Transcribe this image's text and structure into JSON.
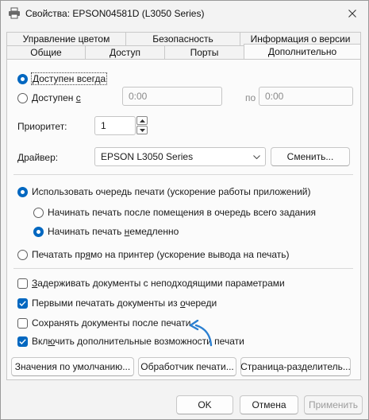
{
  "window": {
    "title": "Свойства: EPSON04581D (L3050 Series)"
  },
  "tabs": {
    "back_row": [
      "Управление цветом",
      "Безопасность",
      "Информация о версии"
    ],
    "front_row": [
      "Общие",
      "Доступ",
      "Порты",
      "Дополнительно"
    ],
    "active": "Дополнительно"
  },
  "availability": {
    "always_label": "Доступен всегда",
    "from_label_pre": "Доступен ",
    "from_label_ul": "с",
    "selected": "always",
    "from_time": "0:00",
    "to_label": "по",
    "to_time": "0:00"
  },
  "priority": {
    "label": "Приоритет:",
    "value": "1"
  },
  "driver": {
    "label": "Драйвер:",
    "value": "EPSON L3050 Series",
    "change_button": "Сменить..."
  },
  "spooling": {
    "use_queue_label": "Использовать очередь печати (ускорение работы приложений)",
    "use_queue_checked": true,
    "start_after_label": "Начинать печать после помещения в очередь всего задания",
    "start_after_checked": false,
    "start_immediately_pre": "Начинать печать ",
    "start_immediately_ul": "н",
    "start_immediately_post": "емедленно",
    "start_immediately_checked": true,
    "direct_pre": "Печатать пр",
    "direct_ul": "я",
    "direct_post": "мо на принтер (ускорение вывода на печать)",
    "direct_checked": false
  },
  "options": [
    {
      "pre": "",
      "ul": "З",
      "post": "адерживать документы с неподходящими параметрами",
      "checked": false
    },
    {
      "pre": "Первыми печатать документы из ",
      "ul": "о",
      "post": "череди",
      "checked": true
    },
    {
      "pre": "Сохранять документы после печати",
      "ul": "",
      "post": "",
      "checked": false
    },
    {
      "pre": "Вкл",
      "ul": "ю",
      "post": "чить дополнительные возможности печати",
      "checked": true
    }
  ],
  "bottom_buttons": {
    "defaults": "Значения по умолчанию...",
    "processor": "Обработчик печати...",
    "separator_page": "Страница-разделитель..."
  },
  "dialog_buttons": {
    "ok": "OK",
    "cancel": "Отмена",
    "apply": "Применить"
  },
  "colors": {
    "accent": "#0067c0",
    "arrow_annotation": "#2b7fd0"
  }
}
